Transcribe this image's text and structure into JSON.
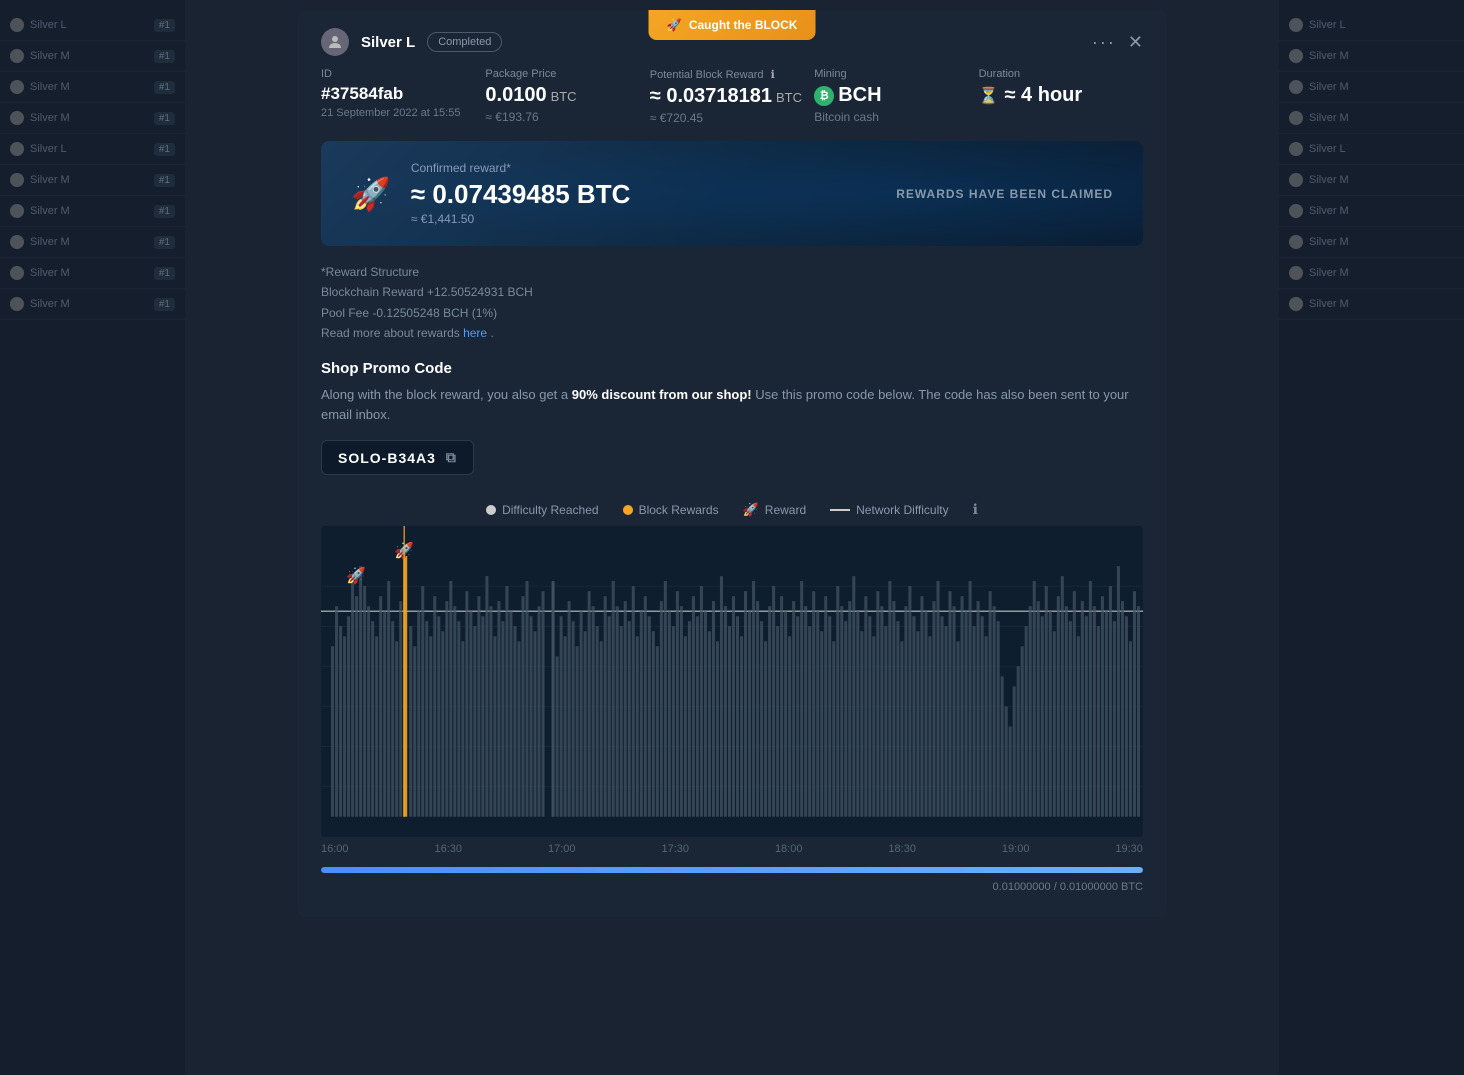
{
  "background": {
    "color": "#1a2332"
  },
  "sidebar": {
    "rows": [
      {
        "label": "Silver L",
        "badge": "#1",
        "type": "silver"
      },
      {
        "label": "Silver M",
        "badge": "#1",
        "type": "silver"
      },
      {
        "label": "Silver M",
        "badge": "#1",
        "type": "silver"
      },
      {
        "label": "Silver M",
        "badge": "#1",
        "type": "silver"
      },
      {
        "label": "Silver L",
        "badge": "#1",
        "type": "silver"
      },
      {
        "label": "Silver M",
        "badge": "#1",
        "type": "silver"
      },
      {
        "label": "Silver M",
        "badge": "#1",
        "type": "silver"
      },
      {
        "label": "Silver M",
        "badge": "#1",
        "type": "silver"
      },
      {
        "label": "Silver M",
        "badge": "#1",
        "type": "silver"
      },
      {
        "label": "Silver M",
        "badge": "#1",
        "type": "silver"
      }
    ]
  },
  "modal": {
    "caught_banner": {
      "rocket": "🚀",
      "text": "Caught the BLOCK"
    },
    "header": {
      "user_name": "Silver L",
      "status": "Completed",
      "dots_label": "···",
      "close_label": "✕"
    },
    "info": {
      "id_label": "ID",
      "id_value": "#37584fab",
      "date": "21 September 2022 at 15:55",
      "package_label": "Package Price",
      "package_value": "0.0100",
      "package_unit": "BTC",
      "package_eur": "≈ €193.76",
      "potential_label": "Potential Block Reward",
      "potential_value": "≈ 0.03718181",
      "potential_unit": "BTC",
      "potential_eur": "≈ €720.45",
      "mining_label": "Mining",
      "mining_currency": "BCH",
      "mining_sub": "Bitcoin cash",
      "duration_label": "Duration",
      "duration_value": "≈ 4 hour"
    },
    "reward_banner": {
      "label": "Confirmed reward*",
      "amount": "≈ 0.07439485 BTC",
      "eur": "≈ €1,441.50",
      "claimed": "REWARDS HAVE BEEN CLAIMED"
    },
    "reward_structure": {
      "title": "*Reward Structure",
      "blockchain": "Blockchain Reward +12.50524931 BCH",
      "pool_fee": "Pool Fee -0.12505248 BCH (1%)",
      "read_more_pre": "Read more about rewards ",
      "read_more_link": "here",
      "read_more_post": "."
    },
    "promo": {
      "title": "Shop Promo Code",
      "desc_pre": "Along with the block reward, you also get a ",
      "desc_bold": "90% discount from our shop!",
      "desc_post": " Use this promo code below. The code has also been sent to your email inbox.",
      "code": "SOLO-B34A3",
      "copy_icon": "⧉"
    },
    "chart": {
      "legend": [
        {
          "type": "dot",
          "color": "white",
          "label": "Difficulty Reached"
        },
        {
          "type": "dot",
          "color": "orange",
          "label": "Block Rewards"
        },
        {
          "type": "rocket",
          "label": "Reward"
        },
        {
          "type": "line",
          "label": "Network Difficulty"
        }
      ],
      "time_labels": [
        "16:00",
        "16:30",
        "17:00",
        "17:30",
        "18:00",
        "18:30",
        "19:00",
        "19:30"
      ],
      "progress_value": "0.01000000 / 0.01000000 BTC"
    }
  }
}
